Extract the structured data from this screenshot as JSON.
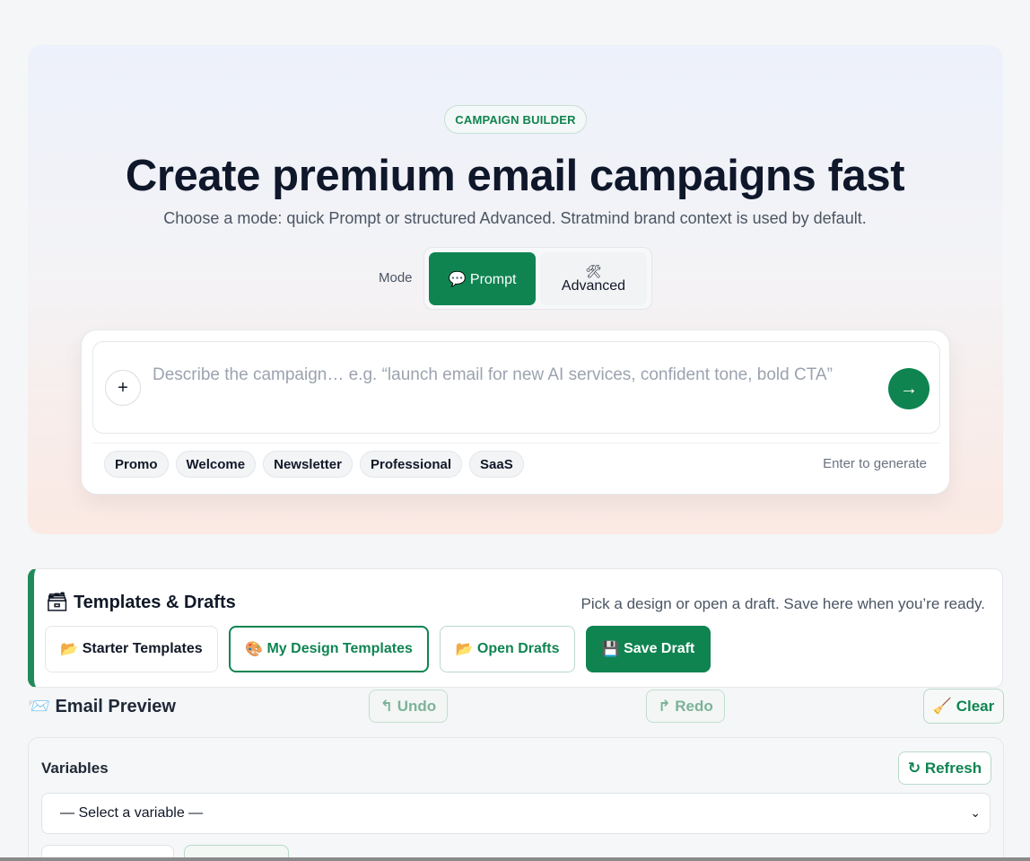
{
  "hero": {
    "badge": "CAMPAIGN BUILDER",
    "title": "Create premium email campaigns fast",
    "subtitle": "Choose a mode: quick Prompt or structured Advanced. Stratmind brand context is used by default.",
    "mode_label": "Mode",
    "modes": [
      {
        "icon": "💬",
        "icon_name": "speech-bubble-icon",
        "label": "Prompt",
        "active": true
      },
      {
        "icon": "🛠",
        "icon_name": "tools-icon",
        "label": "Advanced",
        "active": false
      }
    ]
  },
  "composer": {
    "placeholder": "Describe the campaign… e.g. “launch email for new AI services, confident tone, bold CTA”",
    "plus_icon": "+",
    "send_icon": "→",
    "chips": [
      "Promo",
      "Welcome",
      "Newsletter",
      "Professional",
      "SaaS"
    ],
    "enter_hint": "Enter to generate"
  },
  "templates": {
    "icon": "🗃",
    "title": "Templates & Drafts",
    "hint": "Pick a design or open a draft. Save here when you’re ready.",
    "buttons": {
      "starter": {
        "icon": "📂",
        "label": "Starter Templates"
      },
      "my_design": {
        "icon": "🎨",
        "label": "My Design Templates"
      },
      "open_drafts": {
        "icon": "📂",
        "label": "Open Drafts"
      },
      "save_draft": {
        "icon": "💾",
        "label": "Save Draft"
      }
    }
  },
  "preview": {
    "icon": "📨",
    "title": "Email Preview",
    "undo": {
      "icon": "↰",
      "label": "Undo"
    },
    "redo": {
      "icon": "↱",
      "label": "Redo"
    },
    "clear": {
      "icon": "🧹",
      "label": "Clear"
    }
  },
  "variables": {
    "title": "Variables",
    "refresh": {
      "icon": "↻",
      "label": "Refresh"
    },
    "select_value": "— Select a variable —",
    "chevron": "⌄"
  },
  "colors": {
    "accent": "#0f8451",
    "title": "#0f172a",
    "muted": "#4b5563"
  }
}
